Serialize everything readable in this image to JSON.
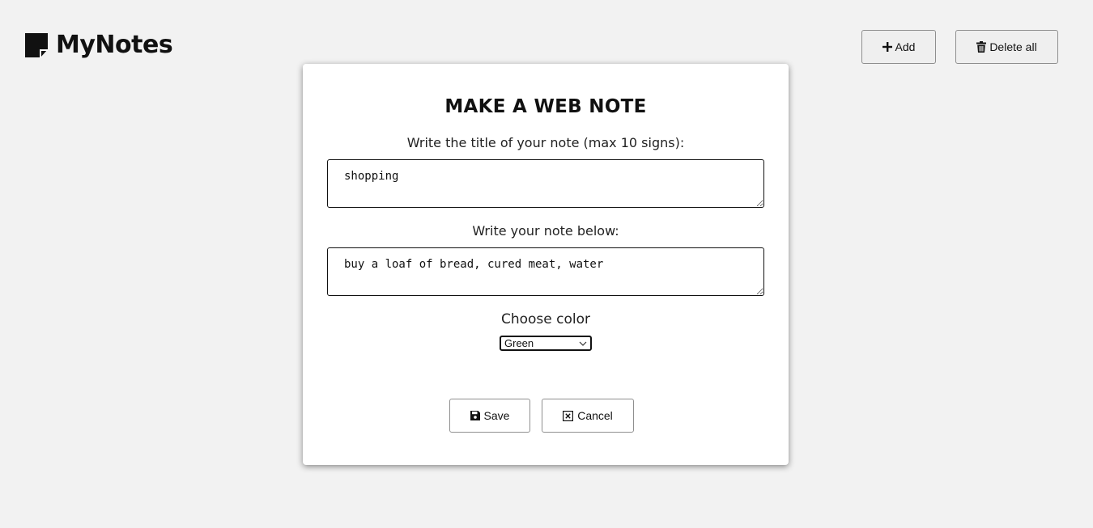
{
  "header": {
    "app_title": "MyNotes",
    "logo_icon": "sticky-note-icon",
    "add_label": "Add",
    "add_icon": "plus-icon",
    "delete_all_label": "Delete all",
    "delete_all_icon": "trash-icon"
  },
  "modal": {
    "title": "MAKE A WEB NOTE",
    "title_label": "Write the title of your note (max 10 signs):",
    "title_value": "shopping",
    "note_label": "Write your note below:",
    "note_value": "buy a loaf of bread, cured meat, water",
    "color_label": "Choose color",
    "color_selected": "Green",
    "save_label": "Save",
    "save_icon": "floppy-disk-icon",
    "cancel_label": "Cancel",
    "cancel_icon": "close-square-icon"
  },
  "colors": {
    "background": "#f2f2f2",
    "modal_background": "#ffffff",
    "text": "#111111"
  }
}
